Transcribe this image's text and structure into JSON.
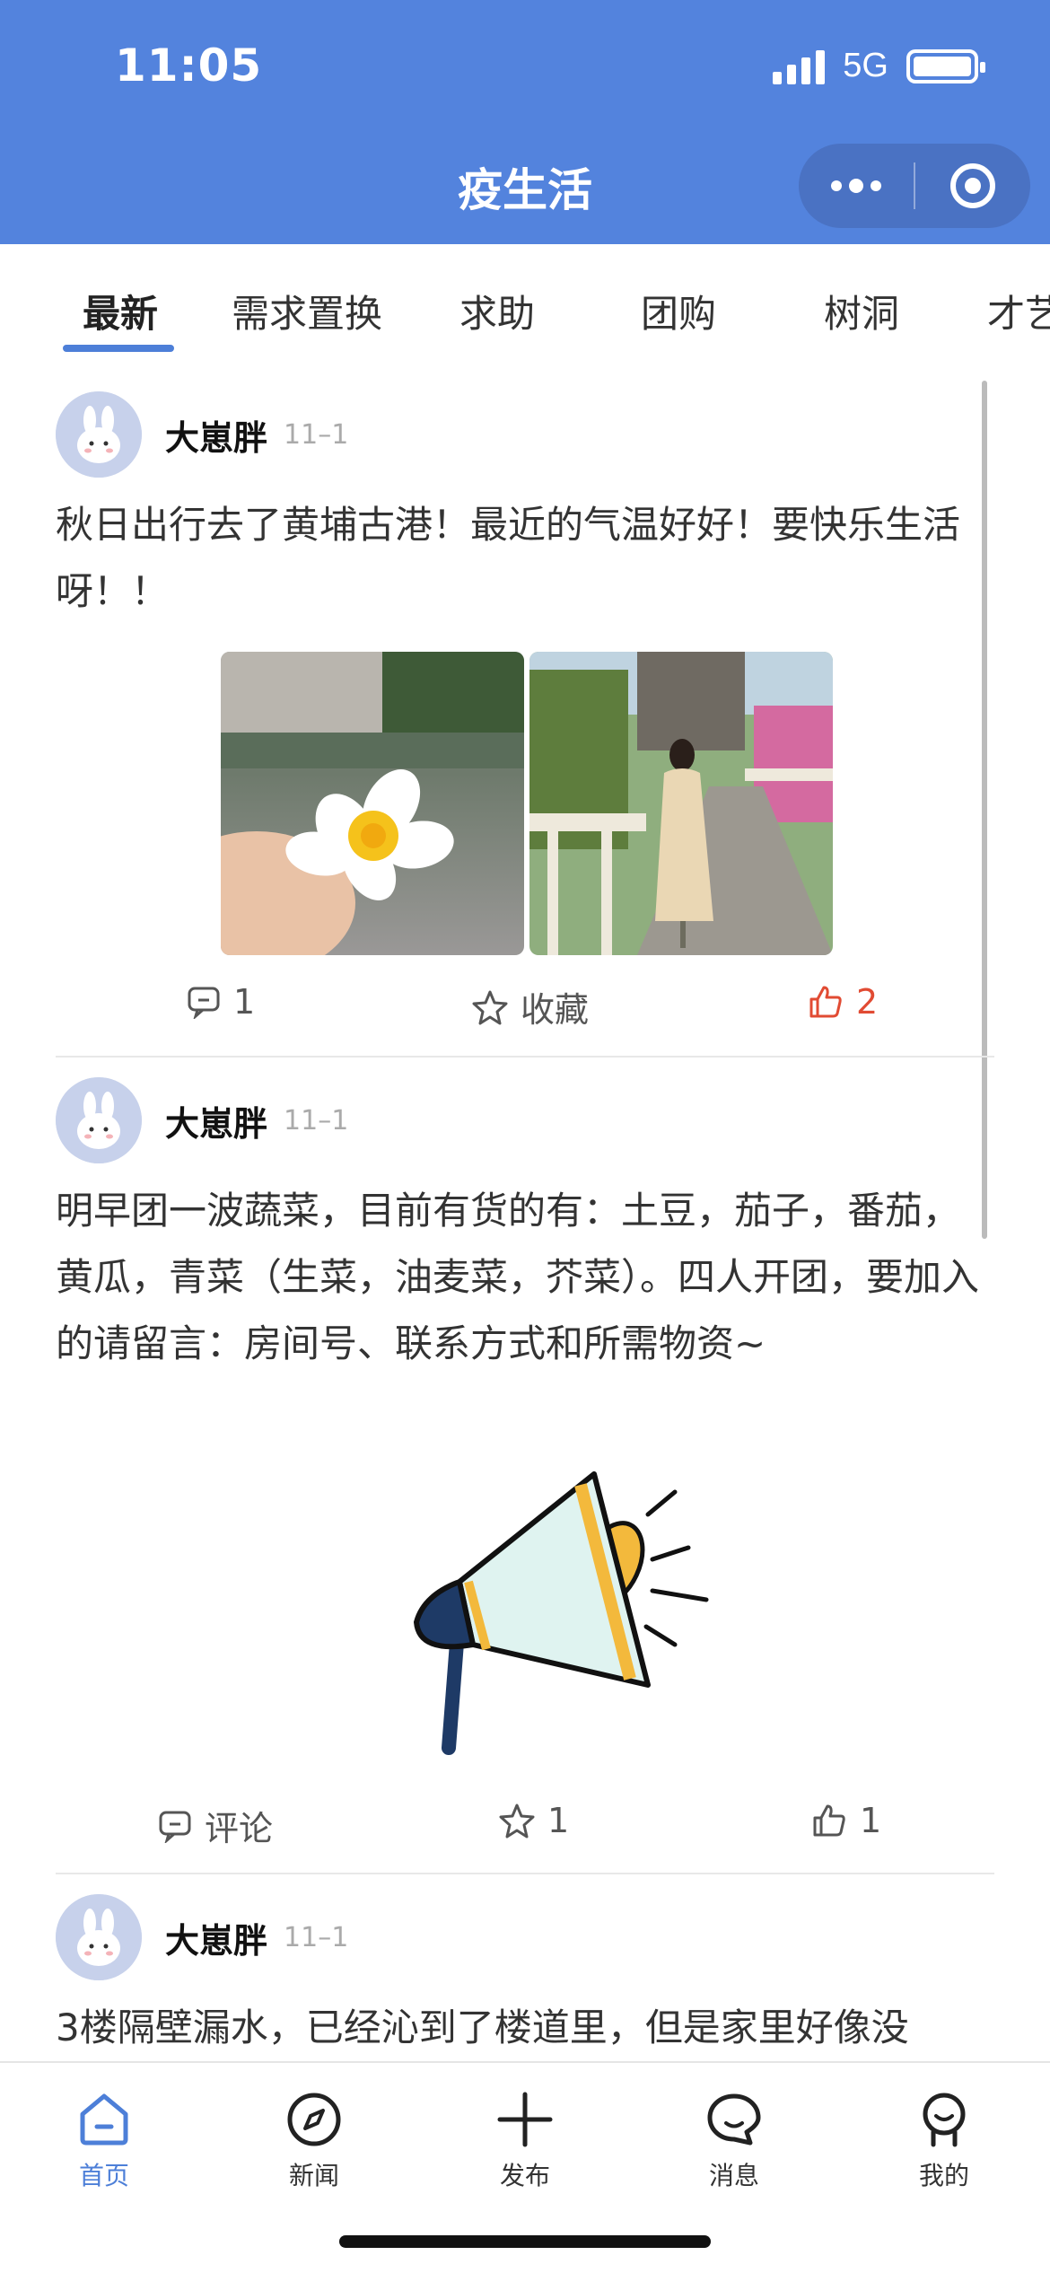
{
  "status_bar": {
    "time": "11:05",
    "network": "5G"
  },
  "header": {
    "title": "疫生活"
  },
  "tabs": [
    {
      "label": "最新",
      "active": true
    },
    {
      "label": "需求置换",
      "active": false
    },
    {
      "label": "求助",
      "active": false
    },
    {
      "label": "团购",
      "active": false
    },
    {
      "label": "树洞",
      "active": false
    },
    {
      "label": "才艺",
      "active": false
    }
  ],
  "posts": [
    {
      "author": "大崽胖",
      "date": "11–1",
      "text": "秋日出行去了黄埔古港！最近的气温好好！要快乐生活呀！！",
      "comments": "1",
      "favorite": "收藏",
      "likes": "2",
      "liked": true
    },
    {
      "author": "大崽胖",
      "date": "11–1",
      "text": "明早团一波蔬菜，目前有货的有：土豆，茄子，番茄，黄瓜，青菜（生菜，油麦菜，芥菜）。四人开团，要加入的请留言：房间号、联系方式和所需物资~",
      "comments": "评论",
      "favorite": "1",
      "likes": "1",
      "liked": false
    },
    {
      "author": "大崽胖",
      "date": "11–1",
      "text": "3楼隔壁漏水，已经沁到了楼道里，但是家里好像没"
    }
  ],
  "bottom_nav": [
    {
      "label": "首页",
      "icon": "home-icon",
      "active": true
    },
    {
      "label": "新闻",
      "icon": "compass-icon",
      "active": false
    },
    {
      "label": "发布",
      "icon": "plus-icon",
      "active": false
    },
    {
      "label": "消息",
      "icon": "message-icon",
      "active": false
    },
    {
      "label": "我的",
      "icon": "profile-icon",
      "active": false
    }
  ],
  "colors": {
    "brand": "#5383DD",
    "accent": "#4D7FD8",
    "like": "#E14B33"
  }
}
